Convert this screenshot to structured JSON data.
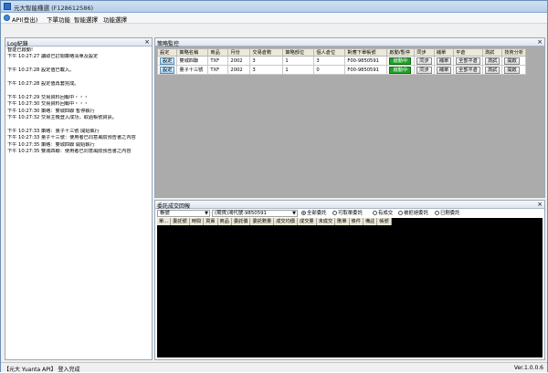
{
  "window": {
    "title": "元大智能種選 (F128612586)"
  },
  "menu": {
    "items": [
      "API(登出)",
      "下單功能",
      "智能選擇",
      "功能選擇"
    ]
  },
  "log_panel": {
    "title": "Log紀錄",
    "lines": [
      "智能已啟動!",
      "下午 10:27:27 讀取已訂閱策略清單及設定",
      "",
      "下午 10:27:28 設定值已載入。",
      "",
      "下午 10:27:28 設定值再套完成。",
      "",
      "下午 10:27:29 交易資料回報中・・・",
      "下午 10:27:30 交易資料回報中・・・",
      "下午 10:27:30 策略：雙城四聯 暫停執行",
      "下午 10:27:32 交易主機登入成功，取過帳號資訊。",
      "",
      "下午 10:27:33 策略：量子十三號 開始執行",
      "下午 10:27:33 量子十三號：使用者已同意風險預告書之內容",
      "下午 10:27:35 策略：雙城四聯 開始執行",
      "下午 10:27:35 雙城四聯：使用者已同意風險預告書之內容"
    ]
  },
  "strategy_panel": {
    "title": "策略監控",
    "columns": [
      "設定",
      "策略名稱",
      "商品",
      "月份",
      "交易倉數",
      "策略部位",
      "個人倉位",
      "對應下單帳號",
      "啟動/暫停",
      "同步",
      "補單",
      "平倉",
      "測試",
      "技術分析"
    ],
    "rows": [
      {
        "set": "設定",
        "name": "雙城四聯",
        "product": "TXF",
        "month": "2002",
        "lots": "3",
        "position": "1",
        "personal": "3",
        "account": "F00-9850591",
        "state": "啟動中",
        "sync": "同步",
        "fill": "補單",
        "close": "全部平倉",
        "test": "測試",
        "analysis": "開啟"
      },
      {
        "set": "設定",
        "name": "量子十三號",
        "product": "TXF",
        "month": "2002",
        "lots": "3",
        "position": "1",
        "personal": "0",
        "account": "F00-9850591",
        "state": "啟動中",
        "sync": "同步",
        "fill": "補單",
        "close": "全部平倉",
        "test": "測試",
        "analysis": "開啟"
      }
    ]
  },
  "orders_panel": {
    "title": "委託成交回報",
    "account_select": "帳號",
    "account_value": "(期貨)鴻代號:9850591",
    "filters": [
      {
        "label": "全部委託",
        "checked": true
      },
      {
        "label": "可取單委託",
        "checked": false
      },
      {
        "label": "有成交",
        "checked": false
      },
      {
        "label": "被拒絕委託",
        "checked": false
      },
      {
        "label": "已刪委託",
        "checked": false
      }
    ],
    "columns": [
      "單...",
      "委託號",
      "時間",
      "買賣",
      "商品",
      "委託價",
      "委託數量",
      "成交均價",
      "成交量",
      "未成交",
      "刪單",
      "條件",
      "備註",
      "帳號"
    ]
  },
  "status": {
    "left": "【元大 Yuanta API】 登入完成",
    "version": "Ver.1.0.0.6"
  }
}
